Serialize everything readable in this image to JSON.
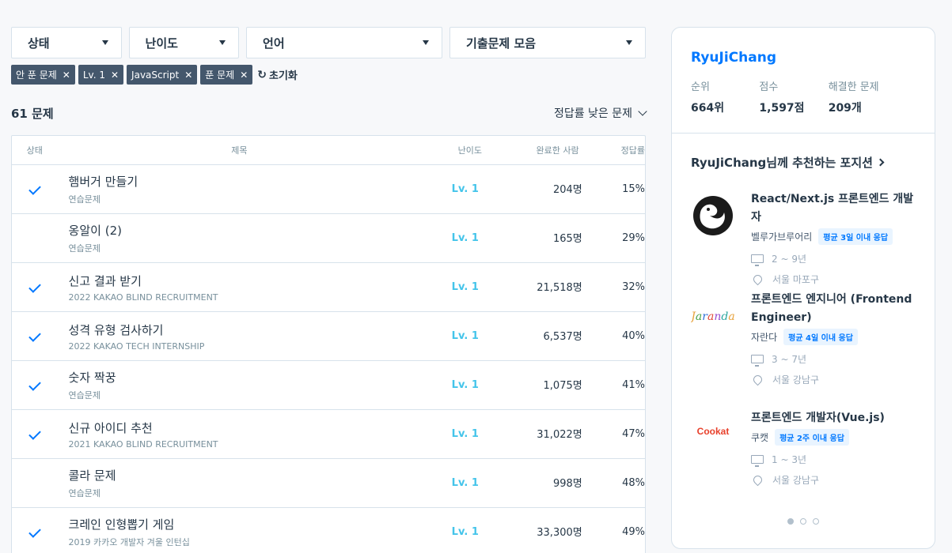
{
  "filters": [
    {
      "label": "상태"
    },
    {
      "label": "난이도"
    },
    {
      "label": "언어"
    },
    {
      "label": "기출문제 모음"
    }
  ],
  "chips": [
    {
      "label": "안 푼 문제"
    },
    {
      "label": "Lv. 1"
    },
    {
      "label": "JavaScript"
    },
    {
      "label": "푼 문제"
    }
  ],
  "reset_label": "초기화",
  "count_label": "61 문제",
  "sort_label": "정답률 낮은 문제",
  "table": {
    "headers": {
      "status": "상태",
      "title": "제목",
      "level": "난이도",
      "done": "완료한 사람",
      "rate": "정답률"
    },
    "rows": [
      {
        "solved": true,
        "title": "햄버거 만들기",
        "source": "연습문제",
        "level": "Lv. 1",
        "done": "204명",
        "rate": "15%"
      },
      {
        "solved": false,
        "title": "옹알이 (2)",
        "source": "연습문제",
        "level": "Lv. 1",
        "done": "165명",
        "rate": "29%"
      },
      {
        "solved": true,
        "title": "신고 결과 받기",
        "source": "2022 KAKAO BLIND RECRUITMENT",
        "level": "Lv. 1",
        "done": "21,518명",
        "rate": "32%"
      },
      {
        "solved": true,
        "title": "성격 유형 검사하기",
        "source": "2022 KAKAO TECH INTERNSHIP",
        "level": "Lv. 1",
        "done": "6,537명",
        "rate": "40%"
      },
      {
        "solved": true,
        "title": "숫자 짝꿍",
        "source": "연습문제",
        "level": "Lv. 1",
        "done": "1,075명",
        "rate": "41%"
      },
      {
        "solved": true,
        "title": "신규 아이디 추천",
        "source": "2021 KAKAO BLIND RECRUITMENT",
        "level": "Lv. 1",
        "done": "31,022명",
        "rate": "47%"
      },
      {
        "solved": false,
        "title": "콜라 문제",
        "source": "연습문제",
        "level": "Lv. 1",
        "done": "998명",
        "rate": "48%"
      },
      {
        "solved": true,
        "title": "크레인 인형뽑기 게임",
        "source": "2019 카카오 개발자 겨울 인턴십",
        "level": "Lv. 1",
        "done": "33,300명",
        "rate": "49%"
      }
    ]
  },
  "profile": {
    "name": "RyuJiChang",
    "stats": [
      {
        "label": "순위",
        "value": "664위"
      },
      {
        "label": "점수",
        "value": "1,597점"
      },
      {
        "label": "해결한 문제",
        "value": "209개"
      }
    ]
  },
  "recommend": {
    "title": "RyuJiChang님께 추천하는 포지션",
    "jobs": [
      {
        "title": "React/Next.js 프론트엔드 개발자",
        "company": "벨루가브루어리",
        "badge": "평균 3일 이내 응답",
        "career": "2 ~ 9년",
        "location": "서울 마포구",
        "logo_text": ""
      },
      {
        "title": "프론트엔드 엔지니어 (Frontend Engineer)",
        "company": "자란다",
        "badge": "평균 4일 이내 응답",
        "career": "3 ~ 7년",
        "location": "서울 강남구",
        "logo_text": "Jaranda"
      },
      {
        "title": "프론트엔드 개발자(Vue.js)",
        "company": "쿠캣",
        "badge": "평균 2주 이내 응답",
        "career": "1 ~ 3년",
        "location": "서울 강남구",
        "logo_text": "Cookat"
      }
    ]
  },
  "colors": {
    "accent": "#0078ff",
    "level": "#44c4ea",
    "chip": "#44576c",
    "cookat": "#e8412c"
  },
  "carousel": {
    "pages": 3,
    "active": 1
  }
}
